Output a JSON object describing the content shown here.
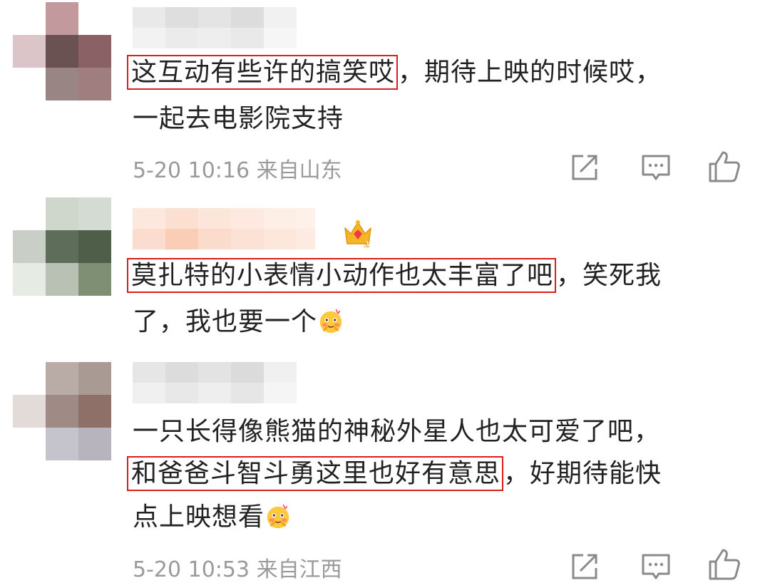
{
  "comments": [
    {
      "highlight": "这互动有些许的搞笑哎",
      "rest_line1": "，期待上映的时候哎，",
      "line2": "一起去电影院支持",
      "time": "5-20 10:16",
      "location": "来自山东"
    },
    {
      "highlight": "莫扎特的小表情小动作也太丰富了吧",
      "rest_line1": "，笑死我",
      "line2": "了，我也要一个",
      "badge_icon": "crown-level-2-icon",
      "emoji_icon": "blush-face-emoji"
    },
    {
      "line1": "一只长得像熊猫的神秘外星人也太可爱了吧，",
      "highlight": "和爸爸斗智斗勇这里也好有意思",
      "rest_line2": "，好期待能快",
      "line3": "点上映想看",
      "emoji_icon": "blush-face-emoji",
      "time": "5-20 10:53",
      "location": "来自江西"
    }
  ],
  "actions": [
    "share-icon",
    "comment-icon",
    "like-icon"
  ],
  "colors": {
    "highlight_border": "#d8201b",
    "text": "#222222",
    "meta": "#9a9a9a"
  }
}
